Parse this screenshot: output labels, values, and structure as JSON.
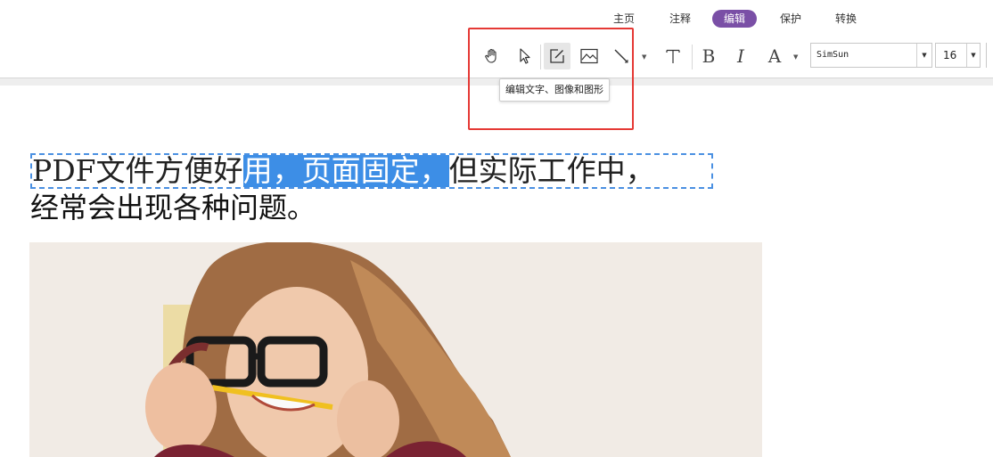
{
  "tabs": [
    {
      "label": "主页"
    },
    {
      "label": "注释"
    },
    {
      "label": "编辑"
    },
    {
      "label": "保护"
    },
    {
      "label": "转换"
    }
  ],
  "toolbar": {
    "bold_label": "B",
    "italic_label": "I",
    "font_color_label": "A",
    "font_name": "SimSun",
    "font_size": "16"
  },
  "tooltip": "编辑文字、图像和图形",
  "document": {
    "line1_before": "PDF文件方便好",
    "line1_selected": "用，页面固定，",
    "line1_after": "但实际工作中，",
    "line2": "经常会出现各种问题。"
  },
  "colors": {
    "active_tab": "#7a4fa6",
    "highlight_border": "#e53935",
    "selection": "#3d8ee6",
    "text_box_border": "#4a90e2"
  }
}
